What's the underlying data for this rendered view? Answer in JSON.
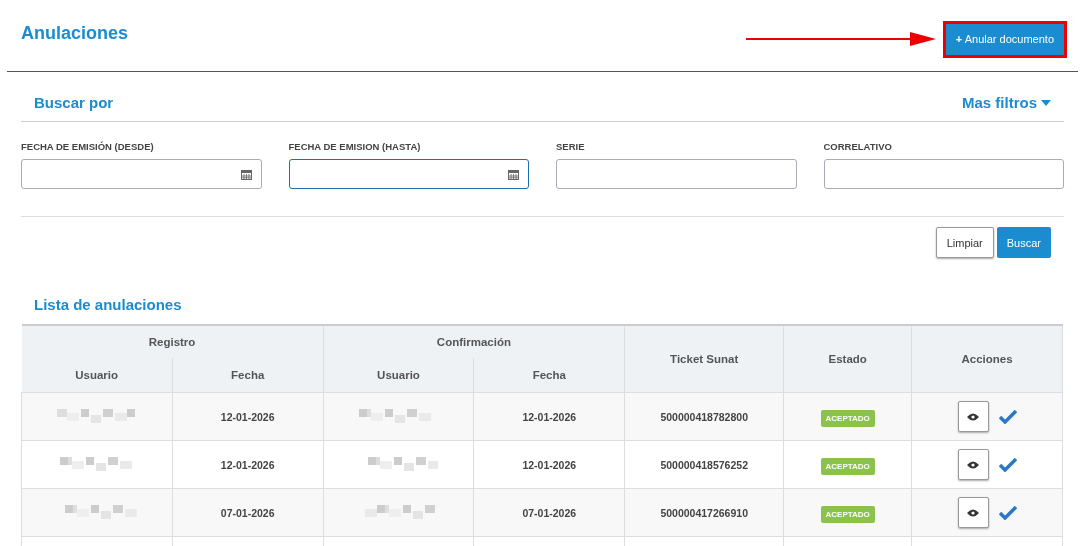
{
  "page": {
    "title": "Anulaciones",
    "primary_action": {
      "label": "Anular documento",
      "icon": "+",
      "highlighted": true
    }
  },
  "filters": {
    "title": "Buscar por",
    "more": "Mas filtros",
    "fields": [
      {
        "label": "FECHA DE EMISIÓN (DESDE)",
        "kind": "date",
        "focused": false
      },
      {
        "label": "FECHA DE EMISION (HASTA)",
        "kind": "date",
        "focused": true
      },
      {
        "label": "SERIE",
        "kind": "text",
        "focused": false
      },
      {
        "label": "CORRELATIVO",
        "kind": "text",
        "focused": false
      }
    ],
    "buttons": [
      {
        "label": "Limpiar",
        "kind": "secondary"
      },
      {
        "label": "Buscar",
        "kind": "primary"
      }
    ]
  },
  "list": {
    "title": "Lista de anulaciones",
    "group_headers": [
      "Registro",
      "Confirmación"
    ],
    "columns": [
      "Usuario",
      "Fecha",
      "Usuario",
      "Fecha",
      "Ticket Sunat",
      "Estado",
      "Acciones"
    ],
    "rows": [
      {
        "registro_fecha": "12-01-2026",
        "confirmacion_fecha": "12-01-2026",
        "ticket": "500000418782800",
        "estado": "ACEPTADO"
      },
      {
        "registro_fecha": "12-01-2026",
        "confirmacion_fecha": "12-01-2026",
        "ticket": "500000418576252",
        "estado": "ACEPTADO"
      },
      {
        "registro_fecha": "07-01-2026",
        "confirmacion_fecha": "07-01-2026",
        "ticket": "500000417266910",
        "estado": "ACEPTADO"
      }
    ]
  }
}
